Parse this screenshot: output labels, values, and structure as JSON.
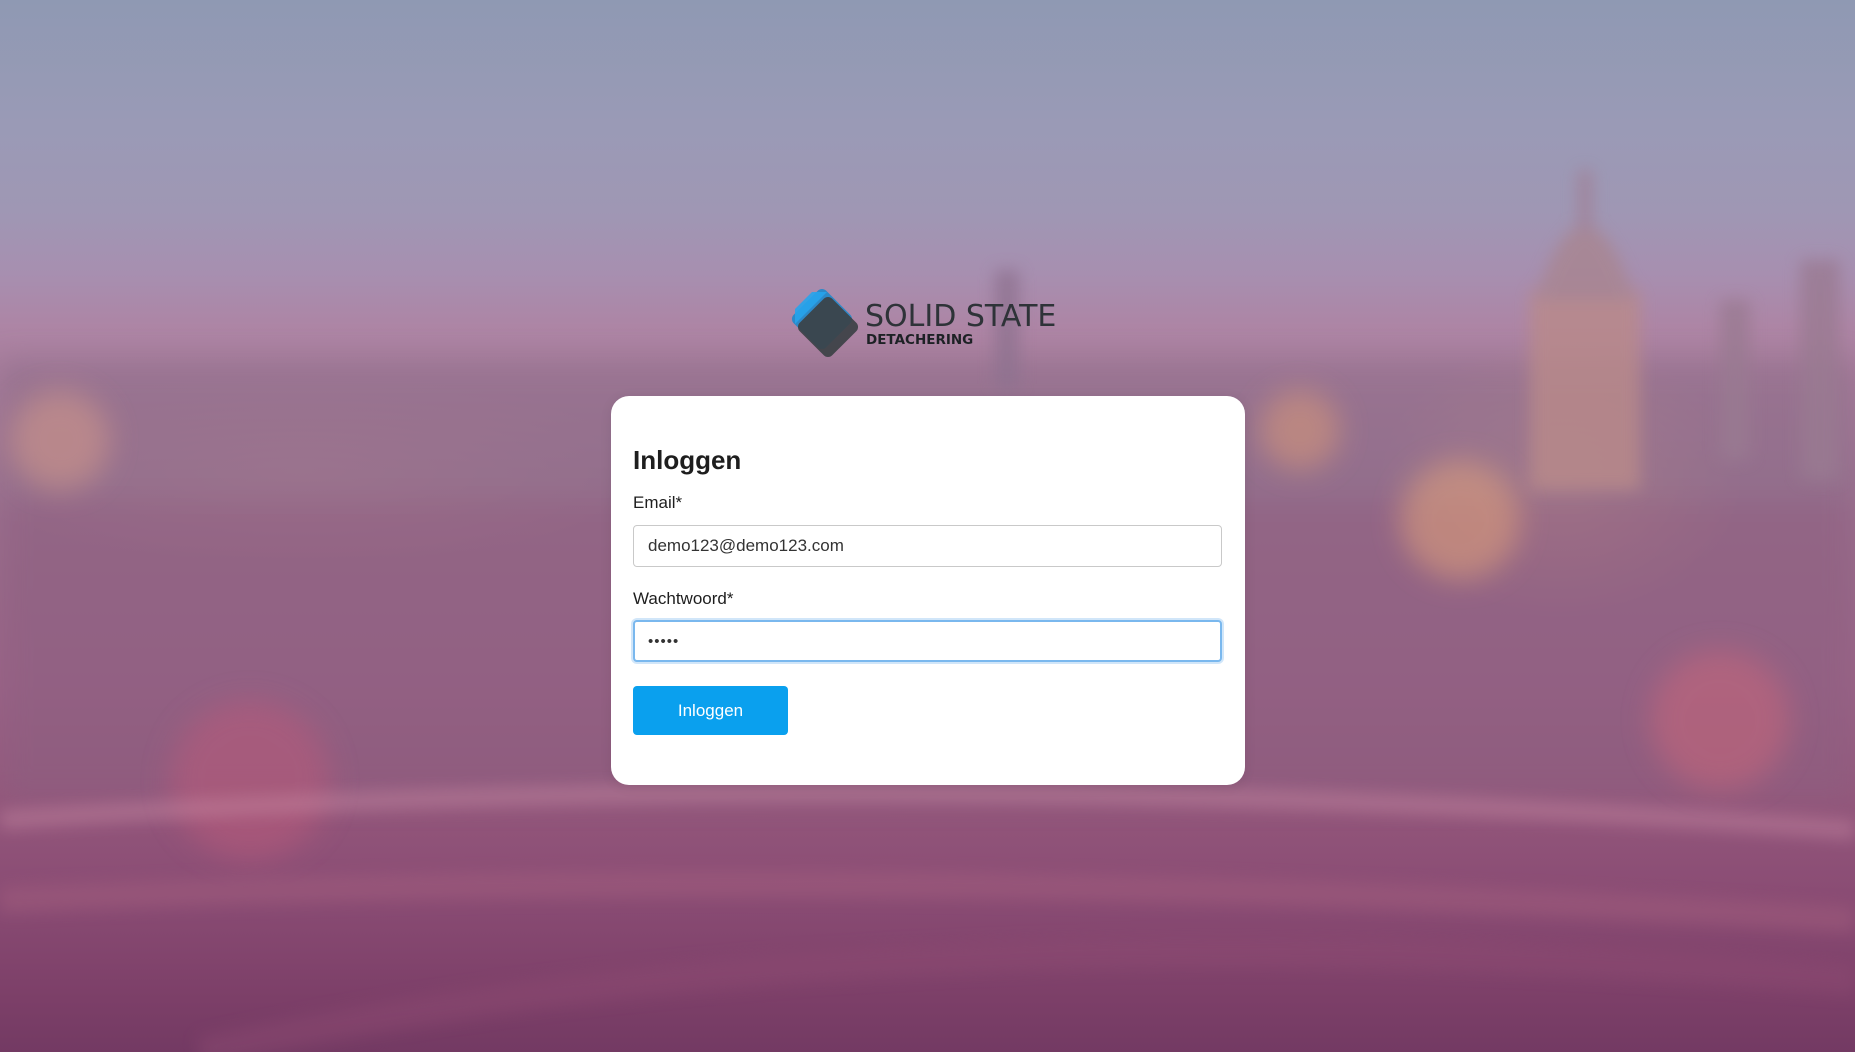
{
  "brand": {
    "name": "SOLID STATE",
    "tagline": "DETACHERING",
    "logo_icon": "diamond-logo-icon",
    "colors": {
      "accent_blue": "#1ea0e6",
      "dark_gray": "#3a3f44"
    }
  },
  "login": {
    "title": "Inloggen",
    "email_label": "Email*",
    "email_value": "demo123@demo123.com",
    "password_label": "Wachtwoord*",
    "password_value": "•••••",
    "submit_label": "Inloggen"
  },
  "colors": {
    "primary_button": "#0aa0ee",
    "focus_ring": "#7ab8ee",
    "card_background": "#ffffff"
  }
}
